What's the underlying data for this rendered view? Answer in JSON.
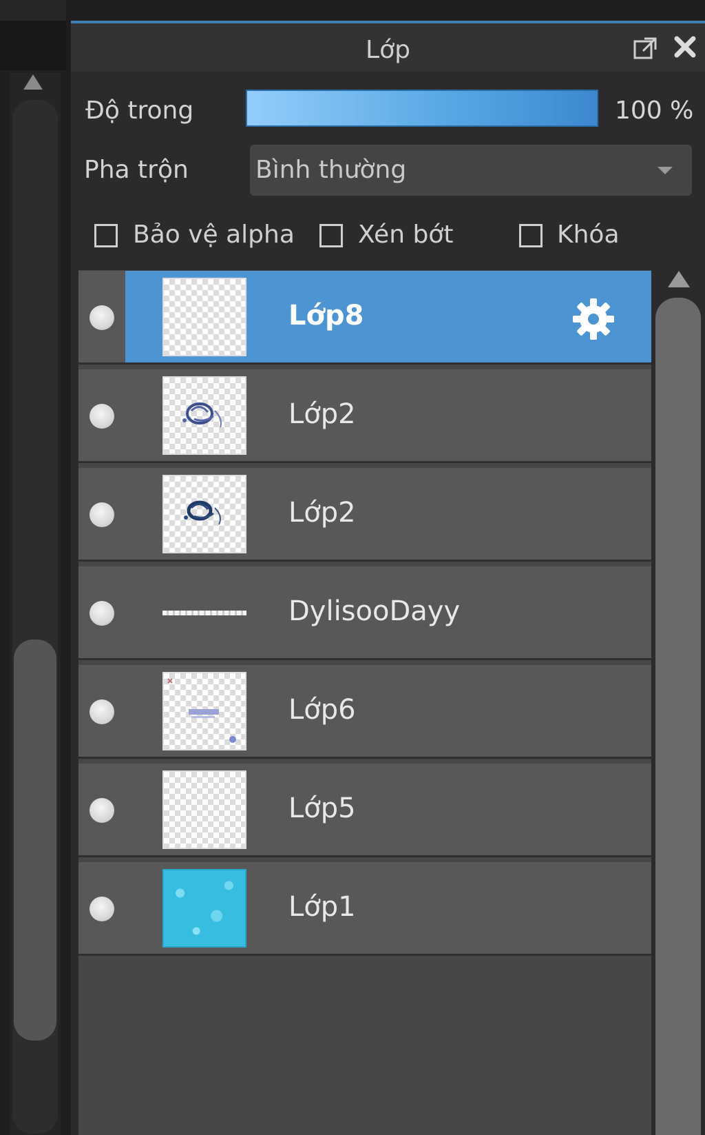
{
  "panel": {
    "title": "Lớp",
    "icons": {
      "popout": "popout-icon",
      "close": "close-icon"
    }
  },
  "opacity": {
    "label": "Độ trong",
    "value_text": "100 %",
    "value": 100
  },
  "blend": {
    "label": "Pha trộn",
    "selected": "Bình thường"
  },
  "checkboxes": [
    {
      "label": "Bảo vệ alpha",
      "checked": false
    },
    {
      "label": "Xén bớt",
      "checked": false
    },
    {
      "label": "Khóa",
      "checked": false
    }
  ],
  "layers": [
    {
      "name": "Lớp8",
      "selected": true,
      "visible": true,
      "thumb": "transparent",
      "icon": "gear-icon"
    },
    {
      "name": "Lớp2",
      "selected": false,
      "visible": true,
      "thumb": "sketch"
    },
    {
      "name": "Lớp2",
      "selected": false,
      "visible": true,
      "thumb": "sketch"
    },
    {
      "name": "DylisooDayy",
      "selected": false,
      "visible": true,
      "thumb": "line"
    },
    {
      "name": "Lớp6",
      "selected": false,
      "visible": true,
      "thumb": "text"
    },
    {
      "name": "Lớp5",
      "selected": false,
      "visible": true,
      "thumb": "transparent"
    },
    {
      "name": "Lớp1",
      "selected": false,
      "visible": true,
      "thumb": "water"
    }
  ],
  "colors": {
    "accent": "#4d94d2",
    "panel_bg": "#2b2b2b",
    "row_bg": "#585858"
  }
}
